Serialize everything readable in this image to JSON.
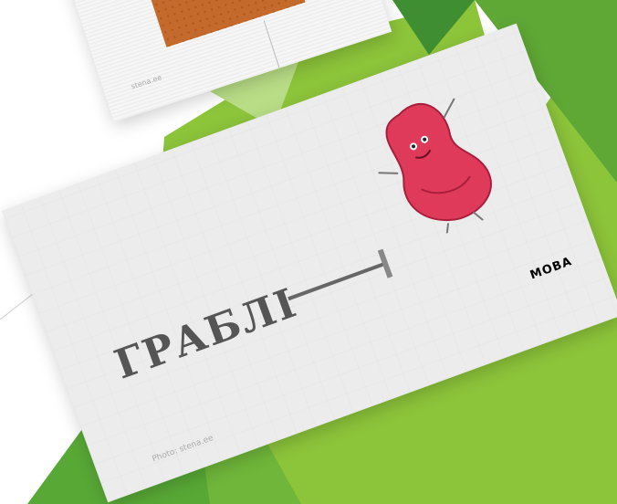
{
  "slide": {
    "word": "ГРАБЛІ",
    "logo": "МОВА",
    "credit": "Photo: stena.ee",
    "back_credit": "stena.ee"
  },
  "colors": {
    "background_green": "#8cc43a",
    "dark_green": "#3f8f32",
    "word_gray": "#555555",
    "blob_pink": "#e03a5a",
    "logo_blue": "#5aa0c8",
    "orange_panel": "#c46a2c"
  },
  "icons": [
    "rake-icon",
    "bean-character-icon"
  ]
}
